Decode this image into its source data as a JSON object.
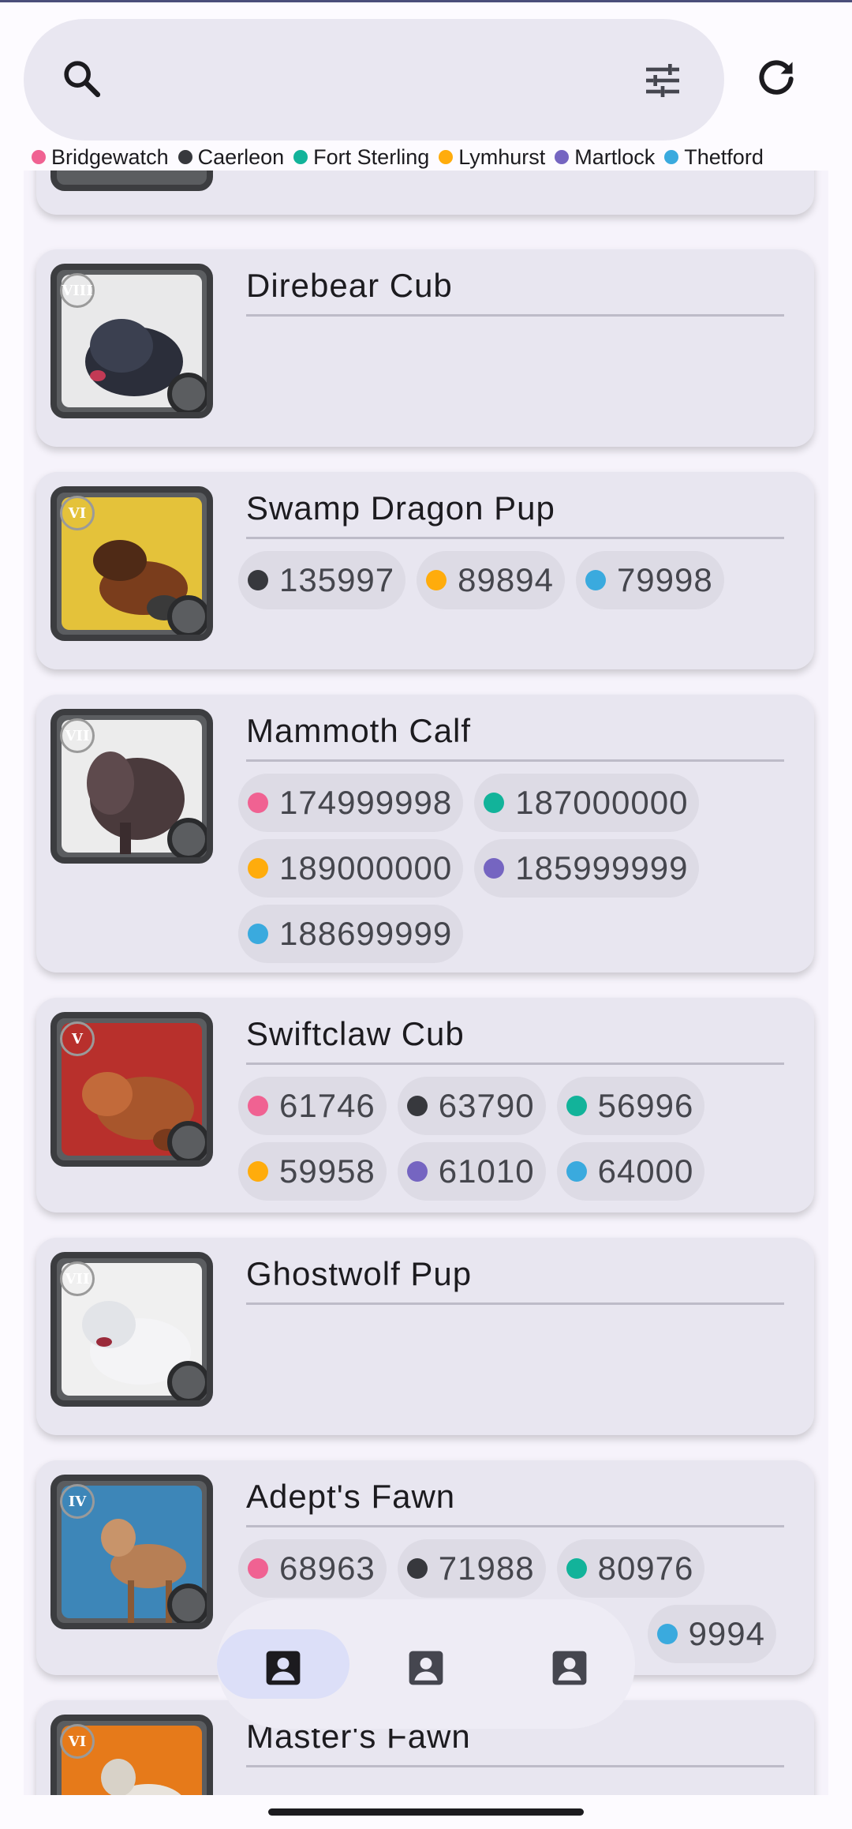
{
  "colors": {
    "bridgewatch": "#f06292",
    "caerleon": "#37383d",
    "fort_sterling": "#12b39a",
    "lymhurst": "#ffac0c",
    "martlock": "#7565c1",
    "thetford": "#3aaade"
  },
  "toolbar": {
    "search_icon": "search-icon",
    "filter_icon": "tune-icon",
    "refresh_icon": "refresh-icon"
  },
  "legend": [
    {
      "label": "Bridgewatch",
      "color": "#f06292"
    },
    {
      "label": "Caerleon",
      "color": "#37383d"
    },
    {
      "label": "Fort Sterling",
      "color": "#12b39a"
    },
    {
      "label": "Lymhurst",
      "color": "#ffac0c"
    },
    {
      "label": "Martlock",
      "color": "#7565c1"
    },
    {
      "label": "Thetford",
      "color": "#3aaade"
    }
  ],
  "items": [
    {
      "name": "Direbear Cub",
      "tier": "VIII",
      "prices": []
    },
    {
      "name": "Swamp Dragon Pup",
      "tier": "VI",
      "prices": [
        {
          "city": "caerleon",
          "value": "135997"
        },
        {
          "city": "lymhurst",
          "value": "89894"
        },
        {
          "city": "thetford",
          "value": "79998"
        }
      ]
    },
    {
      "name": "Mammoth Calf",
      "tier": "VII",
      "prices": [
        {
          "city": "bridgewatch",
          "value": "174999998"
        },
        {
          "city": "fort_sterling",
          "value": "187000000"
        },
        {
          "city": "lymhurst",
          "value": "189000000"
        },
        {
          "city": "martlock",
          "value": "185999999"
        },
        {
          "city": "thetford",
          "value": "188699999"
        }
      ]
    },
    {
      "name": "Swiftclaw Cub",
      "tier": "V",
      "prices": [
        {
          "city": "bridgewatch",
          "value": "61746"
        },
        {
          "city": "caerleon",
          "value": "63790"
        },
        {
          "city": "fort_sterling",
          "value": "56996"
        },
        {
          "city": "lymhurst",
          "value": "59958"
        },
        {
          "city": "martlock",
          "value": "61010"
        },
        {
          "city": "thetford",
          "value": "64000"
        }
      ]
    },
    {
      "name": "Ghostwolf Pup",
      "tier": "VII",
      "prices": []
    },
    {
      "name": "Adept's Fawn",
      "tier": "IV",
      "prices": [
        {
          "city": "bridgewatch",
          "value": "68963"
        },
        {
          "city": "caerleon",
          "value": "71988"
        },
        {
          "city": "fort_sterling",
          "value": "80976"
        },
        {
          "city": "thetford",
          "value": "9994"
        }
      ]
    },
    {
      "name": "Master's Fawn",
      "tier": "VI",
      "prices": []
    }
  ],
  "bottom_nav": [
    {
      "icon": "account-box-icon",
      "selected": true
    },
    {
      "icon": "account-box-icon",
      "selected": false
    },
    {
      "icon": "account-box-icon",
      "selected": false
    }
  ]
}
